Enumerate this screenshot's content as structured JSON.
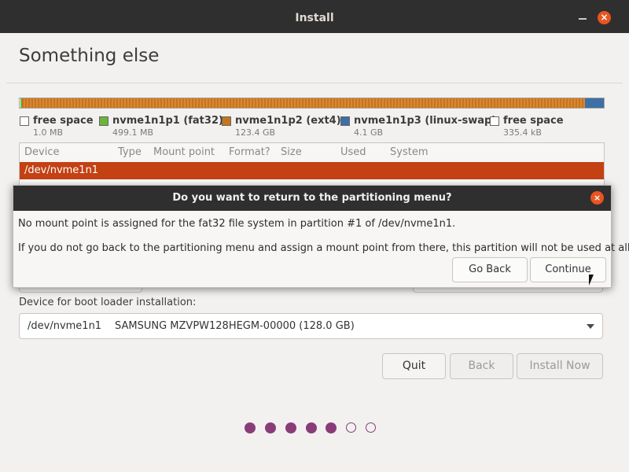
{
  "window": {
    "title": "Install"
  },
  "page": {
    "heading": "Something else"
  },
  "colors": {
    "accent": "#e95420",
    "selection": "#c34113",
    "fat32": "#6db53a",
    "ext4": "#c7741e",
    "swap": "#3e6fa6",
    "progress_dot": "#8a3c78"
  },
  "legend": [
    {
      "label": "free space",
      "size": "1.0 MB"
    },
    {
      "label": "nvme1n1p1 (fat32)",
      "size": "499.1 MB"
    },
    {
      "label": "nvme1n1p2 (ext4)",
      "size": "123.4 GB"
    },
    {
      "label": "nvme1n1p3 (linux-swap)",
      "size": "4.1 GB"
    },
    {
      "label": "free space",
      "size": "335.4 kB"
    }
  ],
  "table": {
    "columns": [
      "Device",
      "Type",
      "Mount point",
      "Format?",
      "Size",
      "Used",
      "System"
    ],
    "selected_row": "/dev/nvme1n1"
  },
  "bootloader": {
    "label": "Device for boot loader installation:",
    "device": "/dev/nvme1n1",
    "model": "SAMSUNG MZVPW128HEGM-00000 (128.0 GB)"
  },
  "buttons": {
    "quit": "Quit",
    "back": "Back",
    "install_now": "Install Now"
  },
  "progress": {
    "total_steps": 7,
    "completed_steps": 5
  },
  "dialog": {
    "title": "Do you want to return to the partitioning menu?",
    "message1": "No mount point is assigned for the fat32 file system in partition #1 of /dev/nvme1n1.",
    "message2": "If you do not go back to the partitioning menu and assign a mount point from there, this partition will not be used at all.",
    "go_back": "Go Back",
    "continue": "Continue"
  }
}
